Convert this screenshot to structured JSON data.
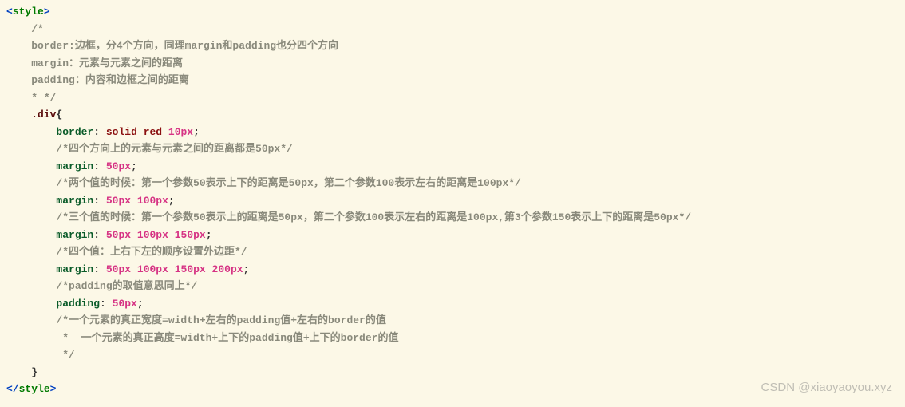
{
  "code": {
    "openTag": "style",
    "closeTag": "style",
    "headerComment": {
      "open": "/*",
      "line1": "border:边框，分4个方向，同理margin和padding也分四个方向",
      "line2": "margin：元素与元素之间的距离",
      "line3": "padding：内容和边框之间的距离",
      "close": "* */"
    },
    "selector": ".div",
    "decls": [
      {
        "prop": "border",
        "value_text": "solid red 10px",
        "comment_after": "/*四个方向上的元素与元素之间的距离都是50px*/"
      },
      {
        "prop": "margin",
        "value_text": "50px",
        "comment_after": "/*两个值的时候：第一个参数50表示上下的距离是50px，第二个参数100表示左右的距离是100px*/"
      },
      {
        "prop": "margin",
        "value_text": "50px 100px",
        "comment_after": "/*三个值的时候：第一个参数50表示上的距离是50px，第二个参数100表示左右的距离是100px,第3个参数150表示上下的距离是50px*/"
      },
      {
        "prop": "margin",
        "value_text": "50px 100px 150px",
        "comment_after": "/*四个值：上右下左的顺序设置外边距*/"
      },
      {
        "prop": "margin",
        "value_text": "50px 100px 150px 200px",
        "comment_after": "/*padding的取值意思同上*/"
      },
      {
        "prop": "padding",
        "value_text": "50px",
        "comment_after": ""
      }
    ],
    "footerComment": {
      "l1": "/*一个元素的真正宽度=width+左右的padding值+左右的border的值",
      "l2": " *  一个元素的真正高度=width+上下的padding值+上下的border的值",
      "l3": " */"
    }
  },
  "watermark": "CSDN @xiaoyaoyou.xyz"
}
